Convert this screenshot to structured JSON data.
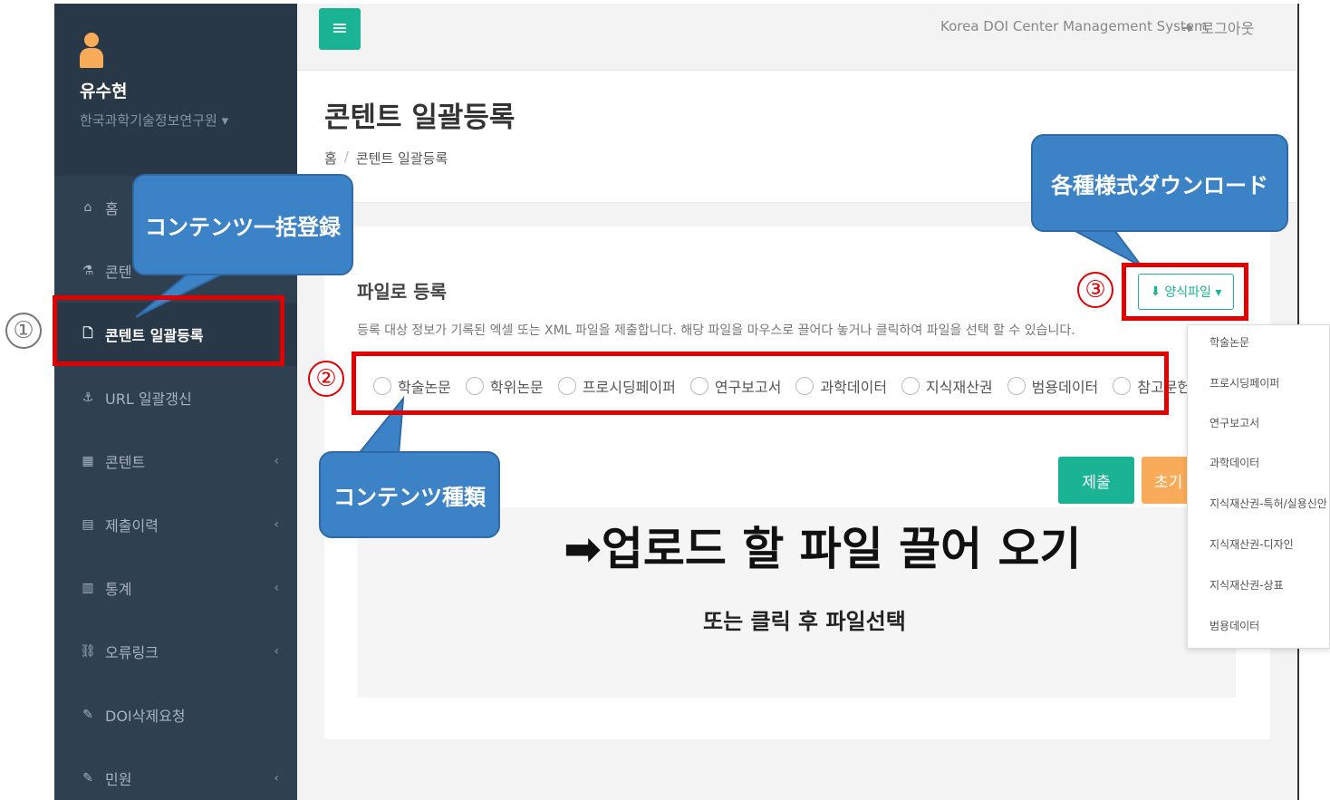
{
  "user": {
    "name": "유수현",
    "org": "한국과학기술정보연구원 ▾"
  },
  "nav": [
    {
      "icon": "home-icon",
      "glyph": "⌂",
      "label": "홈"
    },
    {
      "icon": "flask-icon",
      "glyph": "⚗",
      "label": "콘텐"
    },
    {
      "icon": "file-icon",
      "glyph": "🗋",
      "label": "콘텐트 일괄등록"
    },
    {
      "icon": "anchor-icon",
      "glyph": "⚓",
      "label": "URL 일괄갱신"
    },
    {
      "icon": "grid-icon",
      "glyph": "▦",
      "label": "콘텐트"
    },
    {
      "icon": "list-icon",
      "glyph": "▤",
      "label": "제출이력"
    },
    {
      "icon": "chart-icon",
      "glyph": "▥",
      "label": "통계"
    },
    {
      "icon": "link-icon",
      "glyph": "⛓",
      "label": "오류링크"
    },
    {
      "icon": "edit-icon",
      "glyph": "✎",
      "label": "DOI삭제요청"
    },
    {
      "icon": "edit-icon",
      "glyph": "✎",
      "label": "민원"
    }
  ],
  "topbar": {
    "menu_glyph": "≡",
    "system_title": "Korea DOI Center Management System",
    "logout_label": "로그아웃"
  },
  "page": {
    "title": "콘텐트 일괄등록",
    "breadcrumb": [
      "홈",
      "콘텐트 일괄등록"
    ]
  },
  "form": {
    "section_title": "파일로 등록",
    "description": "등록 대상 정보가 기록된 엑셀 또는 XML 파일을 제출합니다. 해당 파일을 마우스로 끌어다 놓거나 클릭하여 파일을 선택 할 수 있습니다.",
    "template_button": "양식파일 ▾",
    "content_types": [
      "학술논문",
      "학위논문",
      "프로시딩페이퍼",
      "연구보고서",
      "과학데이터",
      "지식재산권",
      "범용데이터",
      "참고문헌"
    ],
    "submit_label": "제출",
    "reset_label": "초기",
    "drop_main": "➡업로드 할 파일 끌어 오기",
    "drop_sub": "또는 클릭 후 파일선택"
  },
  "template_menu": [
    "학술논문",
    "프로시딩페이퍼",
    "연구보고서",
    "과학데이터",
    "지식재산권-특허/실용신안",
    "지식재산권-디자인",
    "지식재산권-상표",
    "범용데이터"
  ],
  "annotations": {
    "num1": "①",
    "num2": "②",
    "num3": "③",
    "callout1": "コンテンツ一括登録",
    "callout2": "コンテンツ種類",
    "callout3": "各種様式ダウンロード"
  },
  "colors": {
    "sidebar": "#2f4050",
    "accent": "#1ab394",
    "warning": "#f8ac59",
    "annotation_red": "#e00000",
    "callout_blue": "#3c82c6"
  }
}
